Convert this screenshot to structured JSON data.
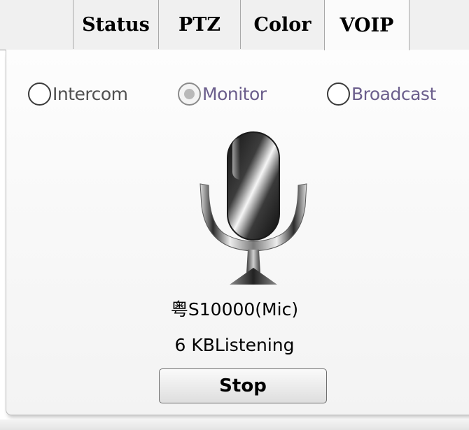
{
  "tabs": [
    {
      "label": "Status"
    },
    {
      "label": "PTZ"
    },
    {
      "label": "Color"
    },
    {
      "label": "VOIP",
      "active": true
    }
  ],
  "modes": [
    {
      "label": "Intercom",
      "selected": false,
      "enabled": true
    },
    {
      "label": "Monitor",
      "selected": true,
      "enabled": false
    },
    {
      "label": "Broadcast",
      "selected": false,
      "enabled": true
    }
  ],
  "device": {
    "name": "粤S10000(Mic)",
    "status": "6 KBListening"
  },
  "actions": {
    "stop_label": "Stop"
  },
  "icons": {
    "microphone": "microphone-icon"
  },
  "colors": {
    "disabled_label": "#6b5e8c",
    "tab_background": "#f0f0f0"
  }
}
